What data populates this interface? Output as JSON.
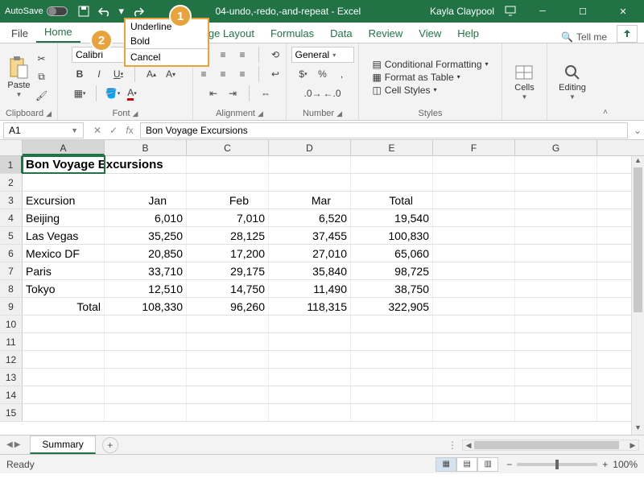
{
  "titlebar": {
    "autosave_label": "AutoSave",
    "doc_title": "04-undo,-redo,-and-repeat - Excel",
    "user": "Kayla Claypool"
  },
  "undo_menu": {
    "items": [
      "Underline",
      "Bold"
    ],
    "cancel": "Cancel"
  },
  "tabs": {
    "file": "File",
    "home": "Home",
    "pagelayout": "age Layout",
    "formulas": "Formulas",
    "data": "Data",
    "review": "Review",
    "view": "View",
    "help": "Help",
    "tellme": "Tell me"
  },
  "ribbon": {
    "clipboard": {
      "label": "Clipboard",
      "paste": "Paste"
    },
    "font": {
      "label": "Font",
      "family": "Calibri",
      "bold": "B",
      "italic": "I",
      "underline": "U"
    },
    "alignment": {
      "label": "Alignment"
    },
    "number": {
      "label": "Number",
      "format": "General"
    },
    "styles": {
      "label": "Styles",
      "cond": "Conditional Formatting",
      "table": "Format as Table",
      "cell": "Cell Styles"
    },
    "cells": {
      "label": "Cells"
    },
    "editing": {
      "label": "Editing"
    }
  },
  "formula": {
    "namebox": "A1",
    "value": "Bon Voyage Excursions"
  },
  "grid": {
    "cols": [
      "A",
      "B",
      "C",
      "D",
      "E",
      "F",
      "G"
    ],
    "title": "Bon Voyage Excursions",
    "headers": [
      "Excursion",
      "Jan",
      "Feb",
      "Mar",
      "Total"
    ],
    "rows": [
      {
        "name": "Beijing",
        "vals": [
          "6,010",
          "7,010",
          "6,520",
          "19,540"
        ]
      },
      {
        "name": "Las Vegas",
        "vals": [
          "35,250",
          "28,125",
          "37,455",
          "100,830"
        ]
      },
      {
        "name": "Mexico DF",
        "vals": [
          "20,850",
          "17,200",
          "27,010",
          "65,060"
        ]
      },
      {
        "name": "Paris",
        "vals": [
          "33,710",
          "29,175",
          "35,840",
          "98,725"
        ]
      },
      {
        "name": "Tokyo",
        "vals": [
          "12,510",
          "14,750",
          "11,490",
          "38,750"
        ]
      }
    ],
    "total_label": "Total",
    "totals": [
      "108,330",
      "96,260",
      "118,315",
      "322,905"
    ]
  },
  "sheet": {
    "name": "Summary"
  },
  "status": {
    "ready": "Ready",
    "zoom": "100%"
  },
  "callouts": {
    "one": "1",
    "two": "2"
  },
  "chart_data": {
    "type": "table",
    "title": "Bon Voyage Excursions",
    "columns": [
      "Excursion",
      "Jan",
      "Feb",
      "Mar",
      "Total"
    ],
    "rows": [
      [
        "Beijing",
        6010,
        7010,
        6520,
        19540
      ],
      [
        "Las Vegas",
        35250,
        28125,
        37455,
        100830
      ],
      [
        "Mexico DF",
        20850,
        17200,
        27010,
        65060
      ],
      [
        "Paris",
        33710,
        29175,
        35840,
        98725
      ],
      [
        "Tokyo",
        12510,
        14750,
        11490,
        38750
      ],
      [
        "Total",
        108330,
        96260,
        118315,
        322905
      ]
    ]
  }
}
